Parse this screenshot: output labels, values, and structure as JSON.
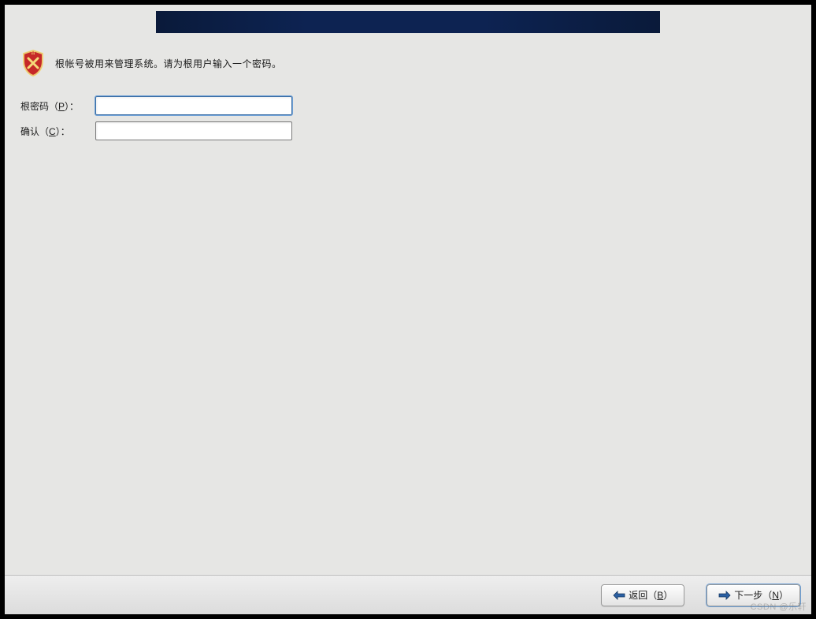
{
  "intro": {
    "text": "根帐号被用来管理系统。请为根用户输入一个密码。"
  },
  "form": {
    "password_label_prefix": "根密码（",
    "password_mnemonic": "P",
    "password_label_suffix": "）：",
    "confirm_label_prefix": "确认（",
    "confirm_mnemonic": "C",
    "confirm_label_suffix": "）：",
    "password_value": "",
    "confirm_value": ""
  },
  "buttons": {
    "back_prefix": "返回（",
    "back_mnemonic": "B",
    "back_suffix": "）",
    "next_prefix": "下一步（",
    "next_mnemonic": "N",
    "next_suffix": "）"
  },
  "watermark": "CSDN @乐轩"
}
